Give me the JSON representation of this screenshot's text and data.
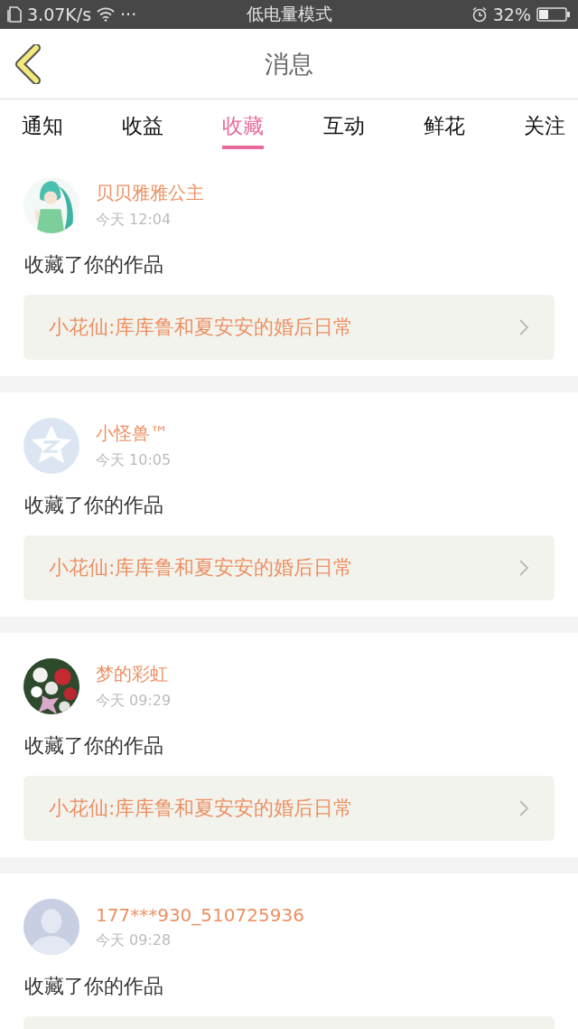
{
  "status_bar": {
    "speed": "3.07K/s",
    "dots": "···",
    "mode": "低电量模式",
    "battery": "32%"
  },
  "header": {
    "title": "消息"
  },
  "tabs": [
    {
      "label": "通知",
      "selected": false
    },
    {
      "label": "收益",
      "selected": false
    },
    {
      "label": "收藏",
      "selected": true
    },
    {
      "label": "互动",
      "selected": false
    },
    {
      "label": "鲜花",
      "selected": false
    },
    {
      "label": "关注",
      "selected": false
    }
  ],
  "messages": [
    {
      "name": "贝贝雅雅公主",
      "time": "今天 12:04",
      "action": "收藏了你的作品",
      "work": "小花仙:库库鲁和夏安安的婚后日常"
    },
    {
      "avatar": {
        "kind": "star"
      },
      "name": "小怪兽™",
      "time": "今天 10:05",
      "action": "收藏了你的作品",
      "work": "小花仙:库库鲁和夏安安的婚后日常"
    },
    {
      "name": "梦的彩虹",
      "time": "今天 09:29",
      "action": "收藏了你的作品",
      "work": "小花仙:库库鲁和夏安安的婚后日常"
    },
    {
      "avatar": {
        "kind": "silhouette"
      },
      "name": "177***930_510725936",
      "time": "今天 09:28",
      "action": "收藏了你的作品"
    }
  ]
}
